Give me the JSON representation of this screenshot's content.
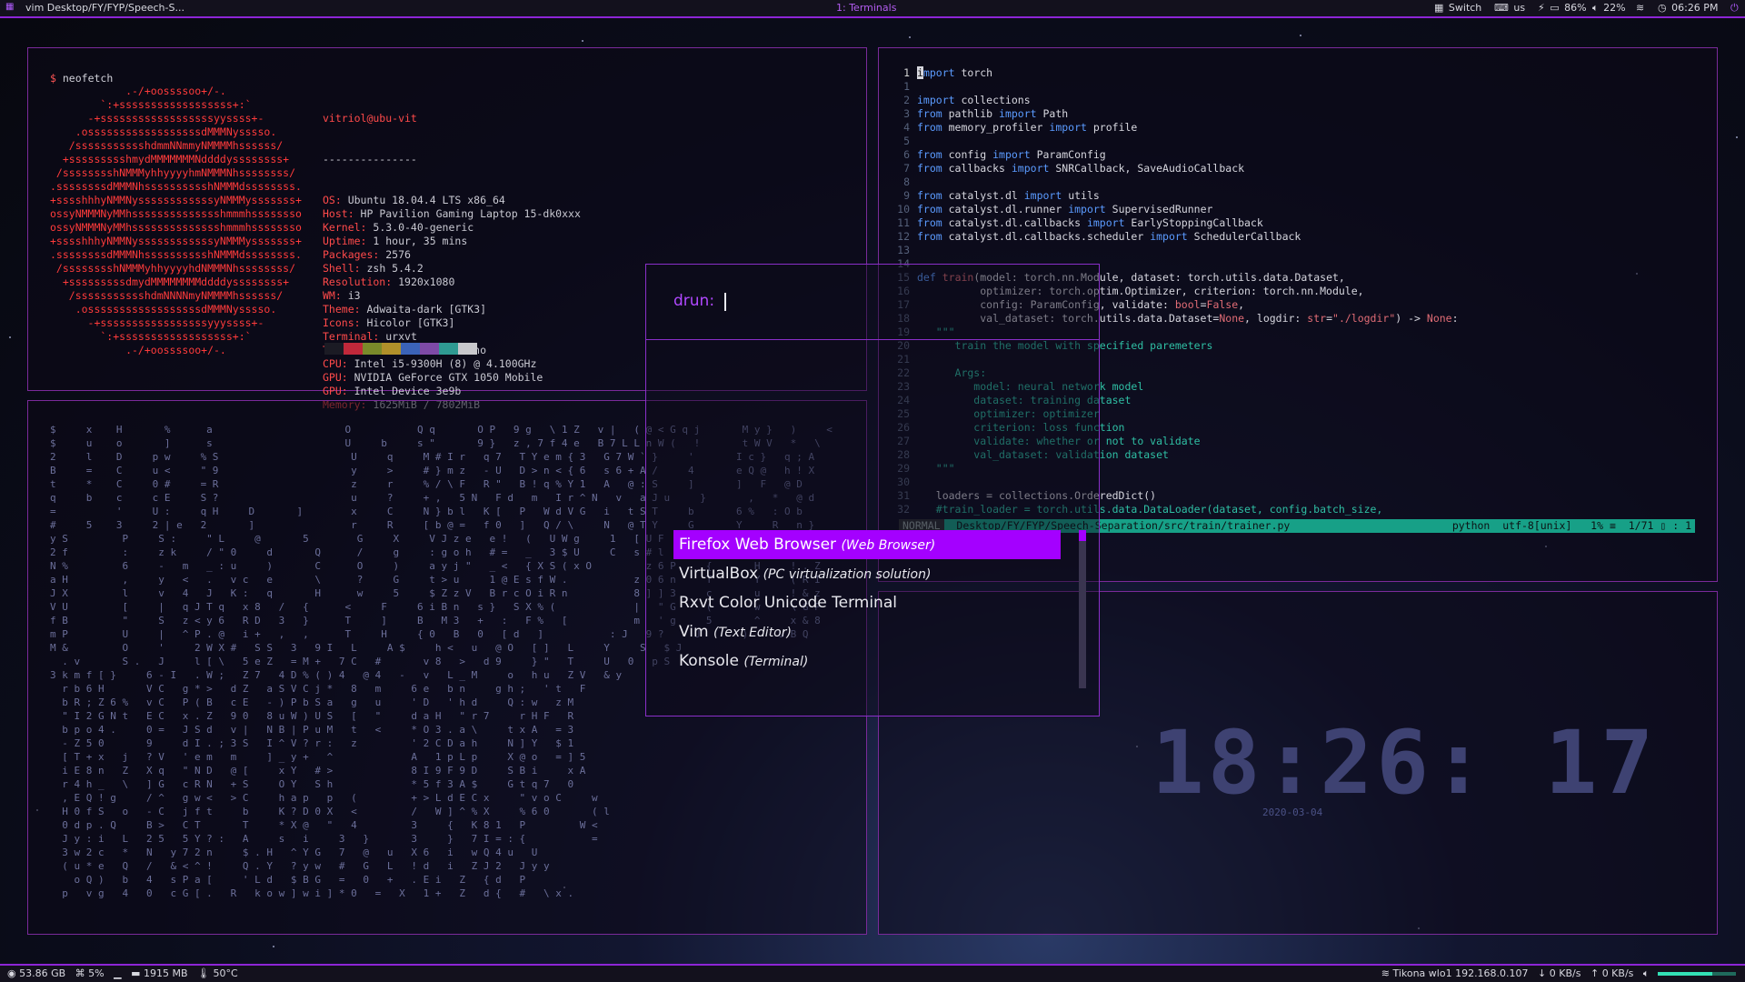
{
  "topbar": {
    "window_title": "vim Desktop/FY/FYP/Speech-S...",
    "workspace": "1: Terminals",
    "switch": "Switch",
    "keyboard": "us",
    "battery": "86%",
    "volume": "22%",
    "time": "06:26 PM",
    "icons": [
      "grid-icon",
      "keyboard-icon",
      "battery-icon",
      "speaker-icon",
      "wifi-icon",
      "clock-icon",
      "power-icon"
    ]
  },
  "neofetch": {
    "command": "neofetch",
    "logo": [
      "            .-/+oossssoo+/-.",
      "        `:+ssssssssssssssssss+:`",
      "      -+ssssssssssssssssssyyssss+-",
      "    .ossssssssssssssssssdMMMNysssso.",
      "   /ssssssssssshdmmNNmmyNMMMMhssssss/",
      "  +ssssssssshmydMMMMMMMNddddyssssssss+",
      " /sssssssshNMMMyhhyyyyhmNMMMNhssssssss/",
      ".ssssssssdMMMNhsssssssssshNMMMdssssssss.",
      "+sssshhhyNMMNyssssssssssssyNMMMysssssss+",
      "ossyNMMMNyMMhsssssssssssssshmmmhssssssso",
      "ossyNMMMNyMMhsssssssssssssshmmmhssssssso",
      "+sssshhhyNMMNyssssssssssssyNMMMysssssss+",
      ".ssssssssdMMMNhsssssssssshNMMMdssssssss.",
      " /sssssssshNMMMyhhyyyyhdNMMMNhssssssss/",
      "  +sssssssssdmydMMMMMMMMddddyssssssss+",
      "   /ssssssssssshdmNNNNmyNMMMMhssssss/",
      "    .ossssssssssssssssssdMMMNysssso.",
      "      -+sssssssssssssssssyyyssss+-",
      "        `:+ssssssssssssssssss+:`",
      "            .-/+oossssoo+/-."
    ],
    "user": "vitriol@ubu-vit",
    "separator": "---------------",
    "info": [
      {
        "key": "OS",
        "value": "Ubuntu 18.04.4 LTS x86_64"
      },
      {
        "key": "Host",
        "value": "HP Pavilion Gaming Laptop 15-dk0xxx"
      },
      {
        "key": "Kernel",
        "value": "5.3.0-40-generic"
      },
      {
        "key": "Uptime",
        "value": "1 hour, 35 mins"
      },
      {
        "key": "Packages",
        "value": "2576"
      },
      {
        "key": "Shell",
        "value": "zsh 5.4.2"
      },
      {
        "key": "Resolution",
        "value": "1920x1080"
      },
      {
        "key": "WM",
        "value": "i3"
      },
      {
        "key": "Theme",
        "value": "Adwaita-dark [GTK3]"
      },
      {
        "key": "Icons",
        "value": "Hicolor [GTK3]"
      },
      {
        "key": "Terminal",
        "value": "urxvt"
      },
      {
        "key": "Terminal Font",
        "value": "Ubuntu Mono"
      },
      {
        "key": "CPU",
        "value": "Intel i5-9300H (8) @ 4.100GHz"
      },
      {
        "key": "GPU",
        "value": "NVIDIA GeForce GTX 1050 Mobile"
      },
      {
        "key": "GPU",
        "value": "Intel Device 3e9b"
      },
      {
        "key": "Memory",
        "value": "1625MiB / 7802MiB"
      }
    ],
    "palette": [
      "#1b1b24",
      "#c0283a",
      "#7a8a2a",
      "#b0902a",
      "#3b63b8",
      "#7e4aa6",
      "#2f9a92",
      "#c8c8cc"
    ]
  },
  "vim": {
    "lines": [
      {
        "n": "1",
        "cur": true,
        "parts": [
          [
            "cursor",
            "i"
          ],
          [
            "kw",
            "mport"
          ],
          [
            "tx",
            " torch"
          ]
        ]
      },
      {
        "n": "1",
        "parts": []
      },
      {
        "n": "2",
        "parts": [
          [
            "kw",
            "import"
          ],
          [
            "tx",
            " collections"
          ]
        ]
      },
      {
        "n": "3",
        "parts": [
          [
            "kw",
            "from"
          ],
          [
            "tx",
            " pathlib "
          ],
          [
            "kw",
            "import"
          ],
          [
            "tx",
            " Path"
          ]
        ]
      },
      {
        "n": "4",
        "parts": [
          [
            "kw",
            "from"
          ],
          [
            "tx",
            " memory_profiler "
          ],
          [
            "kw",
            "import"
          ],
          [
            "tx",
            " profile"
          ]
        ]
      },
      {
        "n": "5",
        "parts": []
      },
      {
        "n": "6",
        "parts": [
          [
            "kw",
            "from"
          ],
          [
            "tx",
            " config "
          ],
          [
            "kw",
            "import"
          ],
          [
            "tx",
            " ParamConfig"
          ]
        ]
      },
      {
        "n": "7",
        "parts": [
          [
            "kw",
            "from"
          ],
          [
            "tx",
            " callbacks "
          ],
          [
            "kw",
            "import"
          ],
          [
            "tx",
            " SNRCallback, SaveAudioCallback"
          ]
        ]
      },
      {
        "n": "8",
        "parts": []
      },
      {
        "n": "9",
        "parts": [
          [
            "kw",
            "from"
          ],
          [
            "tx",
            " catalyst.dl "
          ],
          [
            "kw",
            "import"
          ],
          [
            "tx",
            " utils"
          ]
        ]
      },
      {
        "n": "10",
        "parts": [
          [
            "kw",
            "from"
          ],
          [
            "tx",
            " catalyst.dl.runner "
          ],
          [
            "kw",
            "import"
          ],
          [
            "tx",
            " SupervisedRunner"
          ]
        ]
      },
      {
        "n": "11",
        "parts": [
          [
            "kw",
            "from"
          ],
          [
            "tx",
            " catalyst.dl.callbacks "
          ],
          [
            "kw",
            "import"
          ],
          [
            "tx",
            " EarlyStoppingCallback"
          ]
        ]
      },
      {
        "n": "12",
        "parts": [
          [
            "kw",
            "from"
          ],
          [
            "tx",
            " catalyst.dl.callbacks.scheduler "
          ],
          [
            "kw",
            "import"
          ],
          [
            "tx",
            " SchedulerCallback"
          ]
        ]
      },
      {
        "n": "13",
        "parts": []
      },
      {
        "n": "14",
        "parts": []
      },
      {
        "n": "15",
        "parts": [
          [
            "kw",
            "def"
          ],
          [
            "tx",
            " "
          ],
          [
            "str",
            "train"
          ],
          [
            "tx",
            "(model: torch.nn.Module, dataset: torch.utils.data.Dataset,"
          ]
        ]
      },
      {
        "n": "16",
        "parts": [
          [
            "tx",
            "          optimizer: torch.optim.Optimizer, criterion: torch.nn.Module,"
          ]
        ]
      },
      {
        "n": "17",
        "parts": [
          [
            "tx",
            "          config: ParamConfig, validate: "
          ],
          [
            "str",
            "bool"
          ],
          [
            "tx",
            "="
          ],
          [
            "str",
            "False"
          ],
          [
            "tx",
            ","
          ]
        ]
      },
      {
        "n": "18",
        "parts": [
          [
            "tx",
            "          val_dataset: torch.utils.data.Dataset="
          ],
          [
            "str",
            "None"
          ],
          [
            "tx",
            ", logdir: "
          ],
          [
            "str",
            "str"
          ],
          [
            "tx",
            "="
          ],
          [
            "str",
            "\"./logdir\""
          ],
          [
            "tx",
            ") -> "
          ],
          [
            "str",
            "None"
          ],
          [
            "tx",
            ":"
          ]
        ]
      },
      {
        "n": "19",
        "parts": [
          [
            "cm",
            "   \"\"\""
          ]
        ]
      },
      {
        "n": "20",
        "parts": [
          [
            "cm",
            "      train the model with specified paremeters"
          ]
        ]
      },
      {
        "n": "21",
        "parts": []
      },
      {
        "n": "22",
        "parts": [
          [
            "cm",
            "      Args:"
          ]
        ]
      },
      {
        "n": "23",
        "parts": [
          [
            "cm",
            "         model: neural network model"
          ]
        ]
      },
      {
        "n": "24",
        "parts": [
          [
            "cm",
            "         dataset: training dataset"
          ]
        ]
      },
      {
        "n": "25",
        "parts": [
          [
            "cm",
            "         optimizer: optimizer"
          ]
        ]
      },
      {
        "n": "26",
        "parts": [
          [
            "cm",
            "         criterion: loss function"
          ]
        ]
      },
      {
        "n": "27",
        "parts": [
          [
            "cm",
            "         validate: whether or not to validate"
          ]
        ]
      },
      {
        "n": "28",
        "parts": [
          [
            "cm",
            "         val_dataset: validation dataset"
          ]
        ]
      },
      {
        "n": "29",
        "parts": [
          [
            "cm",
            "   \"\"\""
          ]
        ]
      },
      {
        "n": "30",
        "parts": []
      },
      {
        "n": "31",
        "parts": [
          [
            "tx",
            "   loaders = collections.OrderedDict()"
          ]
        ]
      },
      {
        "n": "32",
        "parts": [
          [
            "cm",
            "   #train_loader = torch.utils.data.DataLoader(dataset, config.batch_size,"
          ]
        ]
      }
    ],
    "status": {
      "mode": "NORMAL",
      "file": "Desktop/FY/FYP/Speech-Separation/src/train/trainer.py",
      "filetype": "python",
      "encoding": "utf-8[unix]",
      "percent": "1%",
      "position": "1/71",
      "col": "1"
    }
  },
  "matrix": {
    "rows": [
      "$     x    H       %      a                      O           Q q       O P   9 g   \\ 1 Z   v |   ( @ < G q j       M y }   )     <",
      "$     u    o       ]      s                      U     b     s \"       9 }   z , 7 f 4 e   B 7 L L n W (   !       t W V   *   \\",
      "2     l    D     p w     % S                      U     q     M # I r   q 7   T Y e m { 3   G 7 W ` }     '       I c }   q ; A",
      "B     =    C     u <     \" 9                      y     >     # } m z   - U   D > n < { 6   s 6 + A /     4       e Q @   h ! X",
      "t     *    C     0 #     = R                      z     r     % / \\ F   R \"   B ! q % Y 1   A   @ : S     ]       ]   F   @ D",
      "q     b    c     c E     S ?                      u     ?     + ,   5 N   F d   m   I r ^ N   v   a J u     }       ,   *   @ d",
      "=          '     U :     q H     D       ]        x     C     N } b l   K [   P   W d V G   i   t S T     b       6 %   : O b",
      "#     5    3     2 | e   2       ]                r     R     [ b @ =   f 0   ]   Q / \\     N   @ T Y     G       Y     R   n }",
      "y S         P     S :     \" L     @       5        G     X     V J z e   e !   (   U W g     1   [ U F     F       !     u   3 [",
      "2 f         :     z k     / \" 0     d       Q      /     g     : g o h   # =   _   3 $ U     C   s # l     g       7     6 I *",
      "N %         6     -   m   _ : u     )       C      O     )     a y j \"   _ <   { X S ( x O         z 6 P     {       H     ! . Z",
      "a H         ,     y   <   .   v c   e       \\      ?     G     t > u     1 @ E s f W .           z 0 6 n     T       Y     ( R I",
      "J X         l     v   4   J   K :   q       H      w     5     $ Z z V   B r c O i R n           8 ] ] 3     c       u     ! & z",
      "V U         [     |   q J T q   x 8   /   {      <     F     6 i B n   s }   S X % (             |   \" G     (       w     \\ G P",
      "f B         \"     S   z < y 6   R D   3   }      T     ]     B   M 3   +   :   F %   [           m   ' g     5       ^     x & 8",
      "m P         U     |   ^ P . @   i +   ,   ,      T     H     { 0   B   0   [ d   ]           : J   9 ?     U       )     U B Q",
      "M &         O     '     2 W X #   S S   3   9 I   L     A $     h <   u   @ O   [ ]   L     Y     S   $ J",
      "  . v       S .   J     l [ \\   5 e Z   = M +   7 C   #       v 8   >   d 9     } \"   T     U   0   p S",
      "3 k m f [ }     6 - I   . W ;   Z 7   4 D % ( ) 4   @ 4   -   v   L _ M     o   h u   Z V   & y",
      "  r b 6 H       V C   g * >   d Z   a S V C j *   8   m     6 e   b n     g h ;   ' t   F",
      "  b R ; Z 6 %   v C   P ( B   c E   - ) P b S a   g   u     ' D   ' h d     Q : w   z M",
      "  \" I 2 G N t   E C   x . Z   9 0   8 u W ) U S   [   \"     d a H   \" r 7     r H F   R",
      "  b p o 4 .     0 =   J S d   v |   N B | P u M   t   <     * O 3 . a \\     t x A   = 3",
      "  - Z 5 0       9     d I . ; 3 S   I ^ V ? r :   z         ' 2 C D a h     N ] Y   $ 1",
      "  [ T + x   j   ? V   ' e m   m     ] _ y +   ^             A   1 p L p     X @ o   = ] 5",
      "  i E 8 n   Z   X q   \" N D   @ [     x Y   # >             8 I 9 F 9 D     S B i     x A",
      "  r 4 h _   \\   ] G   c R N   + S     O Y   S h             * 5 f 3 A $     G t q 7   0",
      "  , E Q ! g     / ^   g w <   > C     h a p   p   (         + > L d E C x     \" v o C     w",
      "  H 0 f S   o   - C   j f t     b     K ? D 0 X   <         /   W ] ^ % X     % 6 0       ( l",
      "  0 d p . Q     B >   C T       T     * X @   \"   4         3     {   K 8 1   P         W <",
      "  J y : i   L   2 5   5 Y ? :   A     s   i     3   }       3     }   7 I = : {           =",
      "  3 w 2 c   *   N   y 7 2 n     $ . H   ^ Y G   7   @   u   X 6   i   w Q 4 u   U",
      "  ( u * e   Q   /   & < ^ !     Q . Y   ? y w   #   G   L   ! d   i   Z J 2   J y y",
      "    o Q )   b   4   s P a [     ' L d   $ B G   =   0   +   . E i   Z   { d   P",
      "  p   v g   4   0   c G [ .   R   k o w ] w i ] * 0   =   X   1 +   Z   d {   #   \\ x ."
    ]
  },
  "rofi": {
    "prompt": "drun:",
    "items": [
      {
        "name": "Firefox Web Browser",
        "desc": "(Web Browser)",
        "selected": true
      },
      {
        "name": "VirtualBox",
        "desc": "(PC virtualization solution)"
      },
      {
        "name": "Rxvt Color Unicode Terminal",
        "desc": ""
      },
      {
        "name": "Vim",
        "desc": "(Text Editor)"
      },
      {
        "name": "Konsole",
        "desc": "(Terminal)"
      }
    ]
  },
  "clock": {
    "time": "18:26: 17",
    "date": "2020-03-04"
  },
  "bottombar": {
    "disk": "53.86 GB",
    "cpu": "5%",
    "ram": "1915 MB",
    "temp": "50°C",
    "wifi": "Tikona wlo1 192.168.0.107",
    "down": "0 KB/s",
    "up": "0 KB/s",
    "volume_level": 0.7
  }
}
